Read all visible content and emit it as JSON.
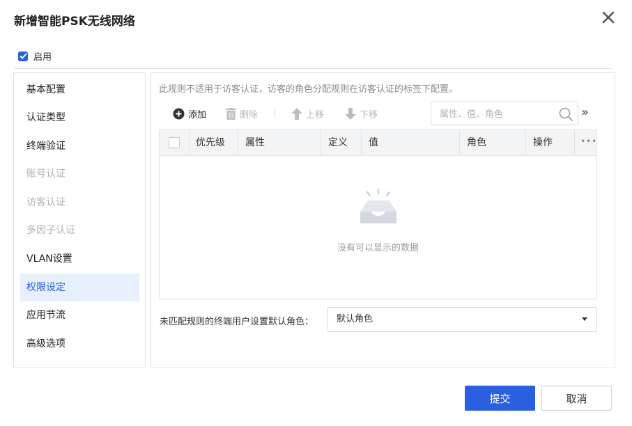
{
  "dialog": {
    "title": "新增智能PSK无线网络",
    "enable_label": "启用",
    "enable_checked": true
  },
  "sidebar": {
    "items": [
      {
        "label": "基本配置",
        "state": "normal"
      },
      {
        "label": "认证类型",
        "state": "normal"
      },
      {
        "label": "终端验证",
        "state": "normal"
      },
      {
        "label": "账号认证",
        "state": "disabled"
      },
      {
        "label": "访客认证",
        "state": "disabled"
      },
      {
        "label": "多因子认证",
        "state": "disabled"
      },
      {
        "label": "VLAN设置",
        "state": "normal"
      },
      {
        "label": "权限设定",
        "state": "active"
      },
      {
        "label": "应用节流",
        "state": "normal"
      },
      {
        "label": "高级选项",
        "state": "normal"
      }
    ]
  },
  "main": {
    "hint": "此规则不适用于访客认证，访客的角色分配规则在访客认证的标签下配置。",
    "toolbar": {
      "add": "添加",
      "delete": "删除",
      "move_up": "上移",
      "move_down": "下移",
      "search_placeholder": "属性、值、角色",
      "expand": "»"
    },
    "table": {
      "columns": [
        "优先级",
        "属性",
        "定义",
        "值",
        "角色",
        "操作"
      ],
      "rows": [],
      "empty_text": "没有可以显示的数据"
    },
    "default_role": {
      "label": "未匹配规则的终端用户设置默认角色：",
      "selected": "默认角色"
    }
  },
  "footer": {
    "submit": "提交",
    "cancel": "取消"
  },
  "colors": {
    "accent": "#2a5fe0",
    "active_bg": "#e8effd",
    "disabled_text": "#b3b3b3"
  },
  "icons": {
    "close": "close-icon",
    "add": "plus-circle-icon",
    "delete": "trash-icon",
    "move_up": "arrow-up-icon",
    "move_down": "arrow-down-icon",
    "search": "search-icon",
    "empty": "empty-inbox-icon",
    "more": "more-icon",
    "select": "caret-down-icon"
  }
}
